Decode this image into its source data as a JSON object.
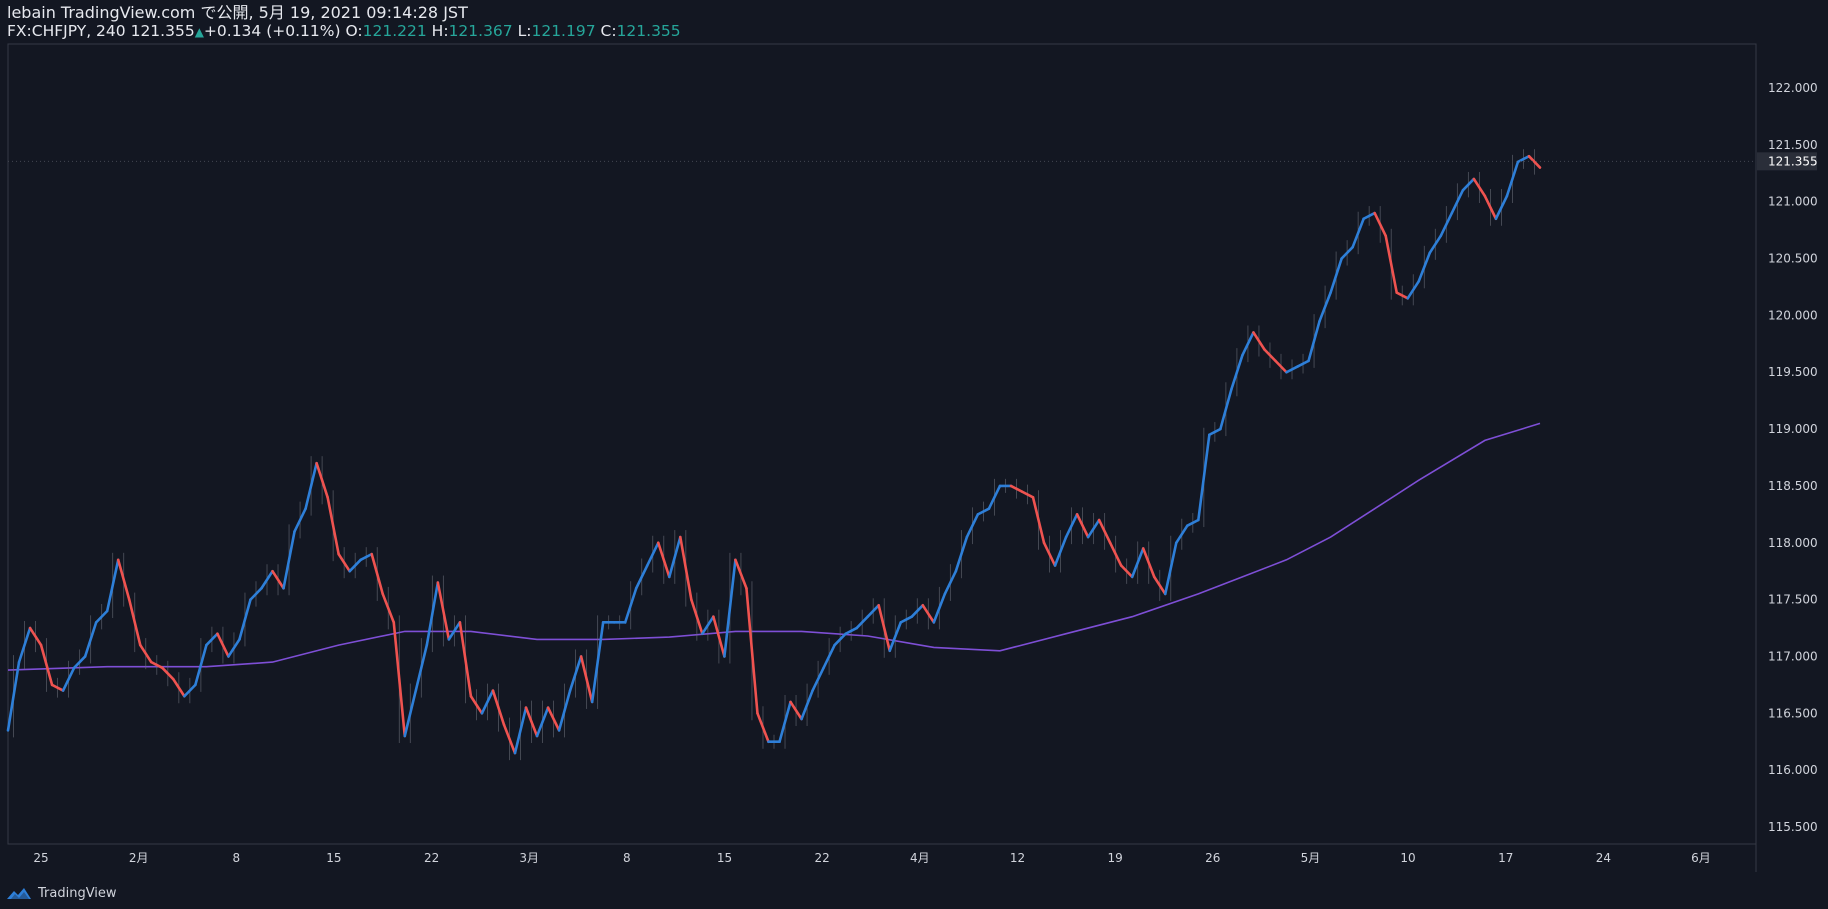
{
  "header": {
    "line1": "lebain TradingView.com で公開, 5月 19, 2021 09:14:28 JST",
    "symbol": "FX:CHFJPY, 240",
    "last": "121.355",
    "arrow": "▲",
    "change": "+0.134 (+0.11%)",
    "o_label": "O:",
    "o_value": "121.221",
    "h_label": "H:",
    "h_value": "121.367",
    "l_label": "L:",
    "l_value": "121.197",
    "c_label": "C:",
    "c_value": "121.355"
  },
  "footer": {
    "brand": "TradingView"
  },
  "colors": {
    "background": "#131722",
    "up": "#2e7fd8",
    "down": "#ef5350",
    "ma": "#7e4fd6",
    "grid": "#363a45",
    "text": "#d1d4dc"
  },
  "chart_data": {
    "type": "line",
    "price_label": "121.355",
    "ylim": [
      115.5,
      122.0
    ],
    "y_ticks": [
      "122.000",
      "121.500",
      "121.000",
      "120.500",
      "120.000",
      "119.500",
      "119.000",
      "118.500",
      "118.000",
      "117.500",
      "117.000",
      "116.500",
      "116.000",
      "115.500"
    ],
    "x_ticks": [
      "25",
      "2月",
      "8",
      "15",
      "22",
      "3月",
      "8",
      "15",
      "22",
      "4月",
      "12",
      "19",
      "26",
      "5月",
      "10",
      "17",
      "24",
      "6月"
    ],
    "price_series": [
      [
        0,
        116.35
      ],
      [
        1,
        116.95
      ],
      [
        2,
        117.25
      ],
      [
        3,
        117.1
      ],
      [
        4,
        116.75
      ],
      [
        5,
        116.7
      ],
      [
        6,
        116.9
      ],
      [
        7,
        117.0
      ],
      [
        8,
        117.3
      ],
      [
        9,
        117.4
      ],
      [
        10,
        117.85
      ],
      [
        11,
        117.5
      ],
      [
        12,
        117.1
      ],
      [
        13,
        116.95
      ],
      [
        14,
        116.9
      ],
      [
        15,
        116.8
      ],
      [
        16,
        116.65
      ],
      [
        17,
        116.75
      ],
      [
        18,
        117.1
      ],
      [
        19,
        117.2
      ],
      [
        20,
        117.0
      ],
      [
        21,
        117.15
      ],
      [
        22,
        117.5
      ],
      [
        23,
        117.6
      ],
      [
        24,
        117.75
      ],
      [
        25,
        117.6
      ],
      [
        26,
        118.1
      ],
      [
        27,
        118.3
      ],
      [
        28,
        118.7
      ],
      [
        29,
        118.4
      ],
      [
        30,
        117.9
      ],
      [
        31,
        117.75
      ],
      [
        32,
        117.85
      ],
      [
        33,
        117.9
      ],
      [
        34,
        117.55
      ],
      [
        35,
        117.3
      ],
      [
        36,
        116.3
      ],
      [
        37,
        116.7
      ],
      [
        38,
        117.1
      ],
      [
        39,
        117.65
      ],
      [
        40,
        117.15
      ],
      [
        41,
        117.3
      ],
      [
        42,
        116.65
      ],
      [
        43,
        116.5
      ],
      [
        44,
        116.7
      ],
      [
        45,
        116.4
      ],
      [
        46,
        116.15
      ],
      [
        47,
        116.55
      ],
      [
        48,
        116.3
      ],
      [
        49,
        116.55
      ],
      [
        50,
        116.35
      ],
      [
        51,
        116.7
      ],
      [
        52,
        117.0
      ],
      [
        53,
        116.6
      ],
      [
        54,
        117.3
      ],
      [
        55,
        117.3
      ],
      [
        56,
        117.3
      ],
      [
        57,
        117.6
      ],
      [
        58,
        117.8
      ],
      [
        59,
        118.0
      ],
      [
        60,
        117.7
      ],
      [
        61,
        118.05
      ],
      [
        62,
        117.5
      ],
      [
        63,
        117.2
      ],
      [
        64,
        117.35
      ],
      [
        65,
        117.0
      ],
      [
        66,
        117.85
      ],
      [
        67,
        117.6
      ],
      [
        68,
        116.5
      ],
      [
        69,
        116.25
      ],
      [
        70,
        116.25
      ],
      [
        71,
        116.6
      ],
      [
        72,
        116.45
      ],
      [
        73,
        116.7
      ],
      [
        74,
        116.9
      ],
      [
        75,
        117.1
      ],
      [
        76,
        117.2
      ],
      [
        77,
        117.25
      ],
      [
        78,
        117.35
      ],
      [
        79,
        117.45
      ],
      [
        80,
        117.05
      ],
      [
        81,
        117.3
      ],
      [
        82,
        117.35
      ],
      [
        83,
        117.45
      ],
      [
        84,
        117.3
      ],
      [
        85,
        117.55
      ],
      [
        86,
        117.75
      ],
      [
        87,
        118.05
      ],
      [
        88,
        118.25
      ],
      [
        89,
        118.3
      ],
      [
        90,
        118.5
      ],
      [
        91,
        118.5
      ],
      [
        92,
        118.45
      ],
      [
        93,
        118.4
      ],
      [
        94,
        118.0
      ],
      [
        95,
        117.8
      ],
      [
        96,
        118.05
      ],
      [
        97,
        118.25
      ],
      [
        98,
        118.05
      ],
      [
        99,
        118.2
      ],
      [
        100,
        118.0
      ],
      [
        101,
        117.8
      ],
      [
        102,
        117.7
      ],
      [
        103,
        117.95
      ],
      [
        104,
        117.7
      ],
      [
        105,
        117.55
      ],
      [
        106,
        118.0
      ],
      [
        107,
        118.15
      ],
      [
        108,
        118.2
      ],
      [
        109,
        118.95
      ],
      [
        110,
        119.0
      ],
      [
        111,
        119.35
      ],
      [
        112,
        119.65
      ],
      [
        113,
        119.85
      ],
      [
        114,
        119.7
      ],
      [
        115,
        119.6
      ],
      [
        116,
        119.5
      ],
      [
        117,
        119.55
      ],
      [
        118,
        119.6
      ],
      [
        119,
        119.95
      ],
      [
        120,
        120.2
      ],
      [
        121,
        120.5
      ],
      [
        122,
        120.6
      ],
      [
        123,
        120.85
      ],
      [
        124,
        120.9
      ],
      [
        125,
        120.7
      ],
      [
        126,
        120.2
      ],
      [
        127,
        120.15
      ],
      [
        128,
        120.3
      ],
      [
        129,
        120.55
      ],
      [
        130,
        120.7
      ],
      [
        131,
        120.9
      ],
      [
        132,
        121.1
      ],
      [
        133,
        121.2
      ],
      [
        134,
        121.05
      ],
      [
        135,
        120.85
      ],
      [
        136,
        121.05
      ],
      [
        137,
        121.35
      ],
      [
        138,
        121.4
      ],
      [
        139,
        121.3
      ]
    ],
    "ma_series": [
      [
        0,
        116.88
      ],
      [
        9,
        116.91
      ],
      [
        18,
        116.91
      ],
      [
        24,
        116.95
      ],
      [
        30,
        117.1
      ],
      [
        36,
        117.22
      ],
      [
        42,
        117.22
      ],
      [
        48,
        117.15
      ],
      [
        54,
        117.15
      ],
      [
        60,
        117.17
      ],
      [
        66,
        117.22
      ],
      [
        72,
        117.22
      ],
      [
        78,
        117.18
      ],
      [
        84,
        117.08
      ],
      [
        90,
        117.05
      ],
      [
        96,
        117.2
      ],
      [
        102,
        117.35
      ],
      [
        108,
        117.55
      ],
      [
        112,
        117.7
      ],
      [
        116,
        117.85
      ],
      [
        120,
        118.05
      ],
      [
        124,
        118.3
      ],
      [
        128,
        118.55
      ],
      [
        134,
        118.9
      ],
      [
        139,
        119.05
      ]
    ]
  }
}
